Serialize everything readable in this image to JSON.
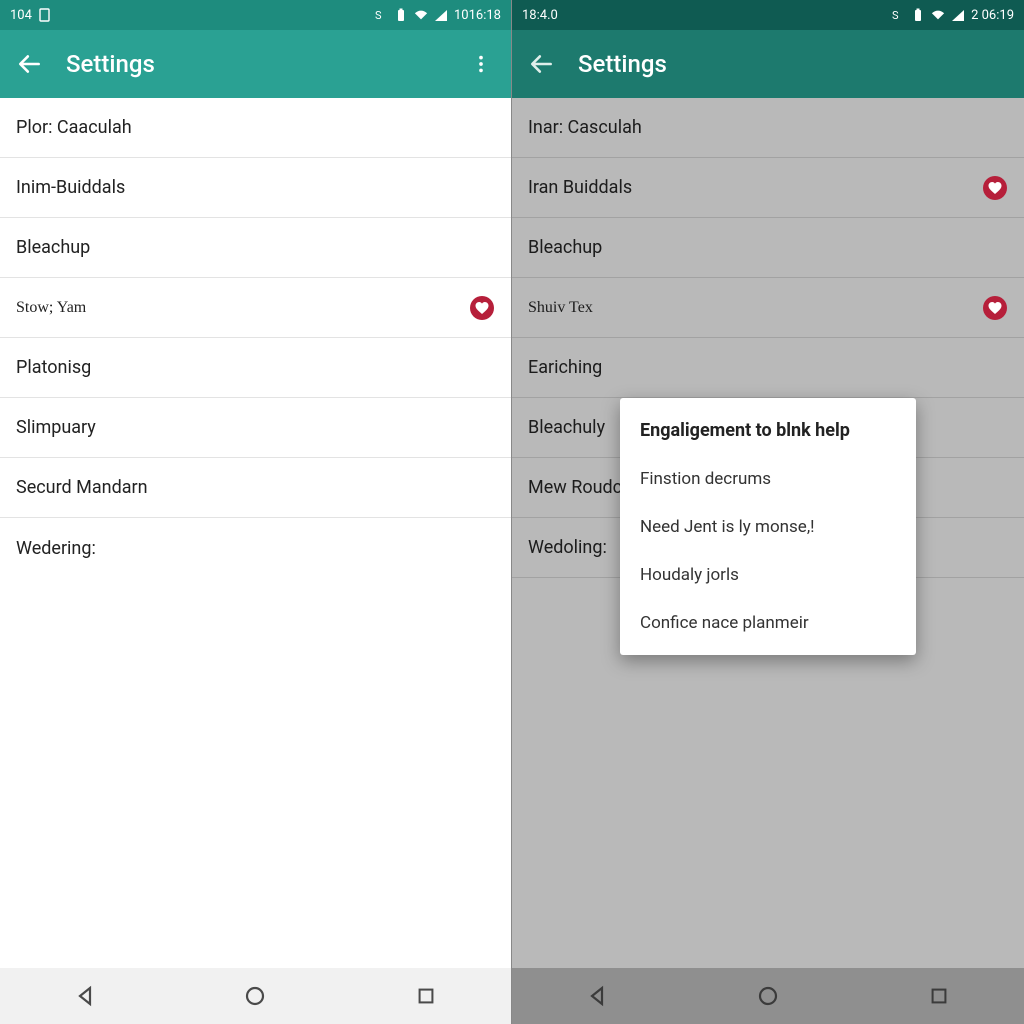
{
  "colors": {
    "leftStatus": "#1e8c7e",
    "leftAppbar": "#2aa193",
    "rightStatus": "#0f5b52",
    "rightAppbar": "#1d7a6e",
    "rightScrim": "#b9b9b9",
    "badge": "#b61f3a"
  },
  "left": {
    "status": {
      "leftText": "104",
      "clock": "1016:18"
    },
    "appbar": {
      "title": "Settings"
    },
    "items": [
      {
        "label": "Plor: Caaculah",
        "badge": false,
        "small": false
      },
      {
        "label": "Inim-Buiddals",
        "badge": false,
        "small": false
      },
      {
        "label": "Bleachup",
        "badge": false,
        "small": false
      },
      {
        "label": "Stow; Yam",
        "badge": true,
        "small": true
      },
      {
        "label": "Platonisg",
        "badge": false,
        "small": false
      },
      {
        "label": "Slimpuary",
        "badge": false,
        "small": false
      },
      {
        "label": "Securd Mandarn",
        "badge": false,
        "small": false
      },
      {
        "label": "Wedering:",
        "badge": false,
        "small": false
      }
    ]
  },
  "right": {
    "status": {
      "leftText": "18:4.0",
      "clock": "2 06:19"
    },
    "appbar": {
      "title": "Settings"
    },
    "items": [
      {
        "label": "Inar: Casculah",
        "badge": false,
        "small": false
      },
      {
        "label": "Iran Buiddals",
        "badge": true,
        "small": false
      },
      {
        "label": "Bleachup",
        "badge": false,
        "small": false
      },
      {
        "label": "Shuiv Tex",
        "badge": true,
        "small": true
      },
      {
        "label": "Eariching",
        "badge": false,
        "small": false
      },
      {
        "label": "Bleachuly",
        "badge": false,
        "small": false
      },
      {
        "label": "Mew Roudc",
        "badge": false,
        "small": false
      },
      {
        "label": "Wedoling:",
        "badge": false,
        "small": false
      }
    ],
    "popup": {
      "title": "Engaligement to blnk help",
      "items": [
        "Finstion decrums",
        "Need Jent is ly monse,!",
        "Houdaly jorls",
        "Confice nace planmeir"
      ]
    }
  }
}
